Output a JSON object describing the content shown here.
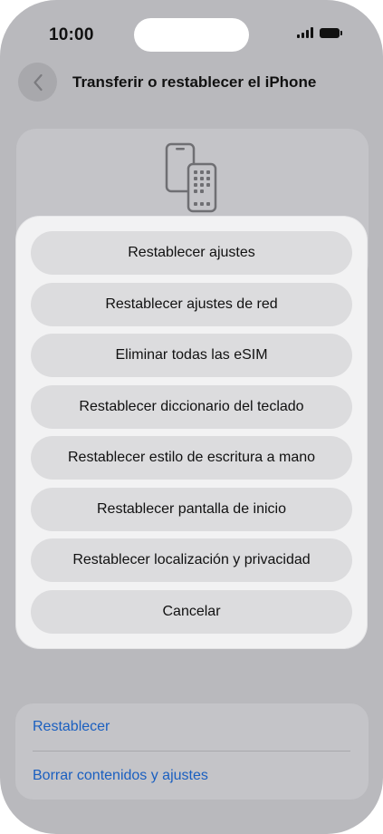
{
  "status_bar": {
    "time": "10:00"
  },
  "nav": {
    "title": "Transferir o restablecer el iPhone"
  },
  "action_sheet": {
    "actions": [
      {
        "label": "Restablecer ajustes"
      },
      {
        "label": "Restablecer ajustes de red"
      },
      {
        "label": "Eliminar todas las eSIM"
      },
      {
        "label": "Restablecer diccionario del teclado"
      },
      {
        "label": "Restablecer estilo de escritura a mano"
      },
      {
        "label": "Restablecer pantalla de inicio"
      },
      {
        "label": "Restablecer localización y privacidad"
      }
    ],
    "cancel_label": "Cancelar"
  },
  "reset_section": {
    "items": [
      {
        "label": "Restablecer"
      },
      {
        "label": "Borrar contenidos y ajustes"
      }
    ]
  },
  "colors": {
    "link": "#1a5fc0",
    "dim_background": "#b9b9bd",
    "sheet_background": "#f2f2f3",
    "button_background": "#dcdcde"
  }
}
